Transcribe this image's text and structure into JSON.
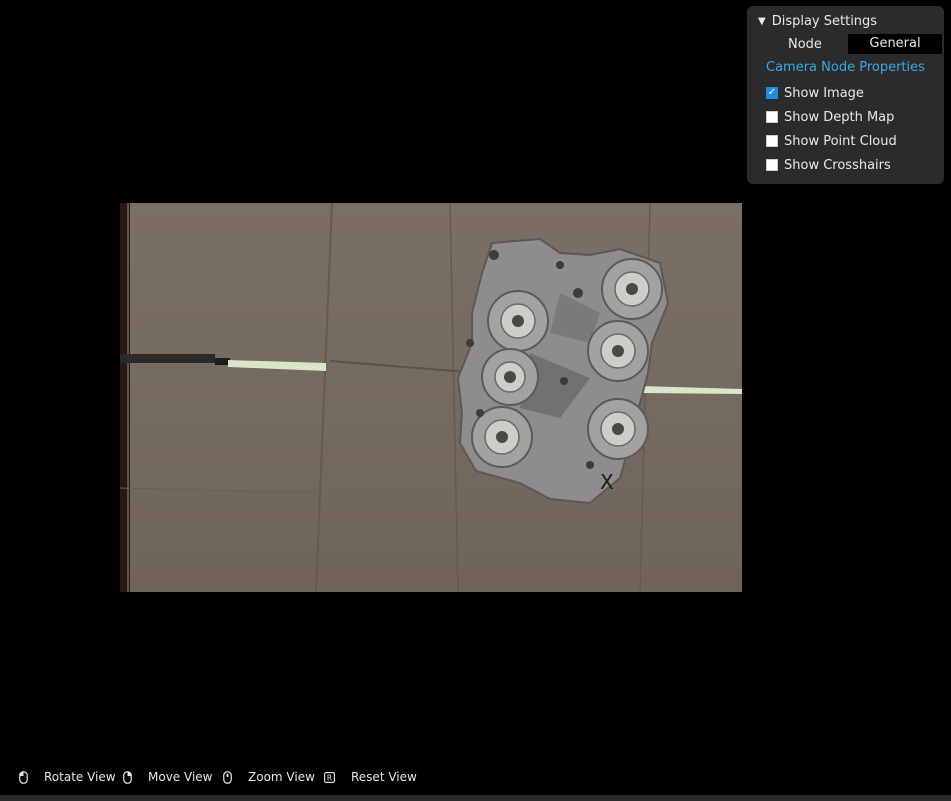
{
  "panel": {
    "title": "Display Settings",
    "node_label": "Node",
    "node_value": "General",
    "properties_link": "Camera Node Properties",
    "checkboxes": [
      {
        "label": "Show Image",
        "checked": true
      },
      {
        "label": "Show Depth Map",
        "checked": false
      },
      {
        "label": "Show Point Cloud",
        "checked": false
      },
      {
        "label": "Show Crosshairs",
        "checked": false
      }
    ]
  },
  "help": {
    "rotate": "Rotate View",
    "rotate_icon": "mouse-left-icon",
    "move": "Move View",
    "move_icon": "mouse-right-icon",
    "zoom": "Zoom View",
    "zoom_icon": "mouse-wheel-icon",
    "reset": "Reset View",
    "reset_icon": "r-key-icon",
    "reset_key": "R"
  },
  "image": {
    "marker": "X"
  },
  "colors": {
    "background": "#000000",
    "panel": "#2b2b2b",
    "link": "#3fa6e6",
    "checkbox_checked": "#1e8de0"
  }
}
